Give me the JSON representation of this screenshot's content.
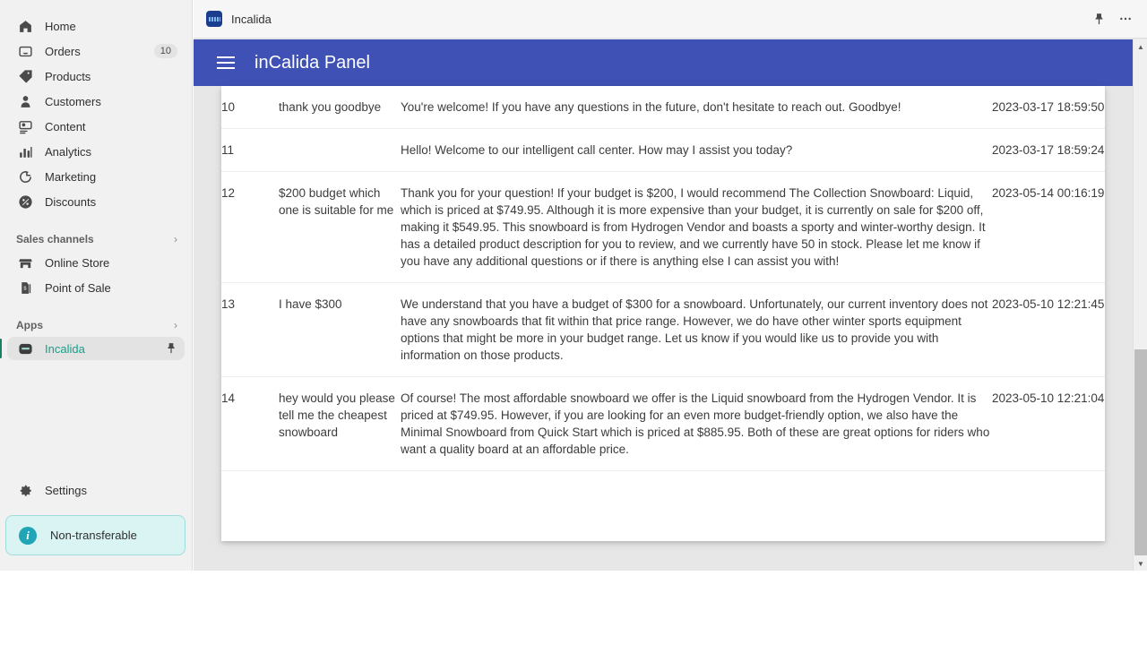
{
  "sidebar": {
    "items": [
      {
        "label": "Home",
        "icon": "home-icon",
        "badge": ""
      },
      {
        "label": "Orders",
        "icon": "orders-icon",
        "badge": "10"
      },
      {
        "label": "Products",
        "icon": "products-tag-icon",
        "badge": ""
      },
      {
        "label": "Customers",
        "icon": "customers-person-icon",
        "badge": ""
      },
      {
        "label": "Content",
        "icon": "content-image-icon",
        "badge": ""
      },
      {
        "label": "Analytics",
        "icon": "analytics-bars-icon",
        "badge": ""
      },
      {
        "label": "Marketing",
        "icon": "marketing-target-icon",
        "badge": ""
      },
      {
        "label": "Discounts",
        "icon": "discounts-percent-icon",
        "badge": ""
      }
    ],
    "sales_channels": {
      "title": "Sales channels",
      "chevron": "›",
      "items": [
        {
          "label": "Online Store",
          "icon": "storefront-icon"
        },
        {
          "label": "Point of Sale",
          "icon": "point-of-sale-icon"
        }
      ]
    },
    "apps": {
      "title": "Apps",
      "chevron": "›",
      "items": [
        {
          "label": "Incalida",
          "icon": "incalida-app-icon",
          "pin": "pin-icon",
          "active": true
        }
      ]
    },
    "settings": {
      "label": "Settings",
      "icon": "gear-icon"
    },
    "banner": {
      "label": "Non-transferable",
      "icon": "info-icon",
      "symbol": "i"
    }
  },
  "tabbar": {
    "app_name": "Incalida",
    "logo": "incalida-logo-icon",
    "pin": "pin-icon",
    "more": "more-options-icon"
  },
  "panel": {
    "menu_icon": "hamburger-menu-icon",
    "title": "inCalida Panel"
  },
  "table": {
    "rows": [
      {
        "id": "10",
        "question": "thank you goodbye",
        "answer": "You're welcome! If you have any questions in the future, don't hesitate to reach out. Goodbye!",
        "date": "2023-03-17 18:59:50"
      },
      {
        "id": "11",
        "question": "",
        "answer": "Hello! Welcome to our intelligent call center. How may I assist you today?",
        "date": "2023-03-17 18:59:24"
      },
      {
        "id": "12",
        "question": "$200 budget which one is suitable for me",
        "answer": "Thank you for your question! If your budget is $200, I would recommend The Collection Snowboard: Liquid, which is priced at $749.95. Although it is more expensive than your budget, it is currently on sale for $200 off, making it $549.95. This snowboard is from Hydrogen Vendor and boasts a sporty and winter-worthy design. It has a detailed product description for you to review, and we currently have 50 in stock. Please let me know if you have any additional questions or if there is anything else I can assist you with!",
        "date": "2023-05-14 00:16:19"
      },
      {
        "id": "13",
        "question": "I have $300",
        "answer": "We understand that you have a budget of $300 for a snowboard. Unfortunately, our current inventory does not have any snowboards that fit within that price range. However, we do have other winter sports equipment options that might be more in your budget range. Let us know if you would like us to provide you with information on those products.",
        "date": "2023-05-10 12:21:45"
      },
      {
        "id": "14",
        "question": "hey would you please tell me the cheapest snowboard",
        "answer": "Of course! The most affordable snowboard we offer is the Liquid snowboard from the Hydrogen Vendor. It is priced at $749.95. However, if you are looking for an even more budget-friendly option, we also have the Minimal Snowboard from Quick Start which is priced at $885.95. Both of these are great options for riders who want a quality board at an affordable price.",
        "date": "2023-05-10 12:21:04"
      }
    ]
  },
  "scrollbar": {
    "up": "▲",
    "down": "▼"
  },
  "colors": {
    "panel_blue": "#3f51b5",
    "accent_teal": "#1a9e88",
    "sidebar_bg": "#f1f1f1",
    "banner_bg": "#d9f4f3"
  }
}
